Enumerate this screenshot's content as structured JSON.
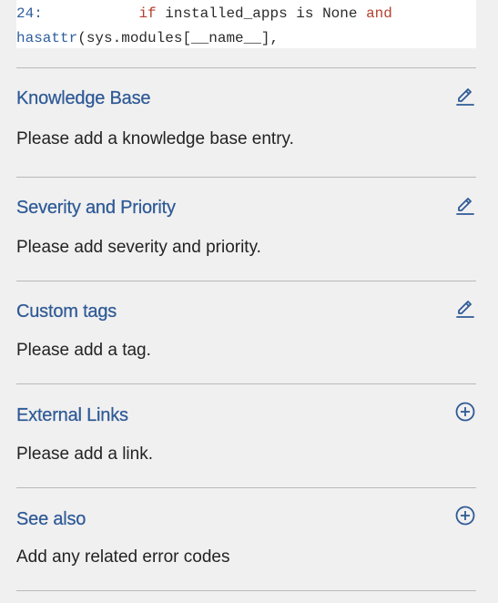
{
  "code": {
    "line_number": "24:",
    "line1_kw": "if",
    "line1_rest": " installed_apps is None ",
    "line1_and": "and",
    "line2_fn": "hasattr",
    "line2_rest": "(sys.modules[__name__],"
  },
  "sections": [
    {
      "title": "Knowledge Base",
      "body": "Please add a knowledge base entry.",
      "action_icon": "edit-icon"
    },
    {
      "title": "Severity and Priority",
      "body": "Please add severity and priority.",
      "action_icon": "edit-icon"
    },
    {
      "title": "Custom tags",
      "body": "Please add a tag.",
      "action_icon": "edit-icon"
    },
    {
      "title": "External Links",
      "body": "Please add a link.",
      "action_icon": "add-circle-icon"
    },
    {
      "title": "See also",
      "body": "Add any related error codes",
      "action_icon": "add-circle-icon"
    }
  ],
  "colors": {
    "title": "#2f5a96",
    "body_text": "#232323",
    "divider": "#b9b9b9",
    "background": "#f0f0f0",
    "keyword": "#b5402f"
  }
}
